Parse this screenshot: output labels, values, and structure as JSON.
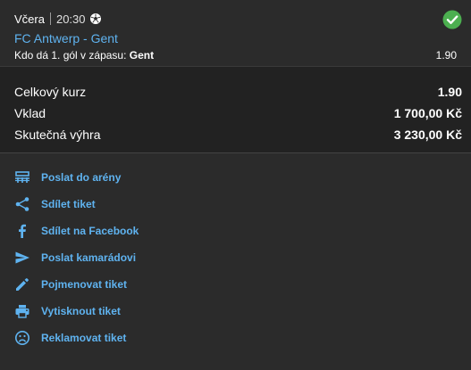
{
  "bet": {
    "day": "Včera",
    "time": "20:30",
    "match": "FC Antwerp - Gent",
    "market_label": "Kdo dá 1. gól v zápasu:",
    "market_value": "Gent",
    "odds": "1.90",
    "sport_icon": "soccer-ball-icon",
    "status_icon": "check-circle-icon"
  },
  "summary": {
    "total_odds_label": "Celkový kurz",
    "total_odds_value": "1.90",
    "stake_label": "Vklad",
    "stake_value": "1 700,00 Kč",
    "payout_label": "Skutečná výhra",
    "payout_value": "3 230,00 Kč"
  },
  "actions": [
    {
      "label": "Poslat do arény",
      "icon": "arena-icon"
    },
    {
      "label": "Sdílet tiket",
      "icon": "share-icon"
    },
    {
      "label": "Sdílet na Facebook",
      "icon": "facebook-icon"
    },
    {
      "label": "Poslat kamarádovi",
      "icon": "send-icon"
    },
    {
      "label": "Pojmenovat tiket",
      "icon": "pencil-icon"
    },
    {
      "label": "Vytisknout tiket",
      "icon": "printer-icon"
    },
    {
      "label": "Reklamovat tiket",
      "icon": "sad-face-icon"
    }
  ],
  "colors": {
    "accent": "#5fb3f0",
    "win": "#4caf50",
    "background": "#2b2b2b",
    "summary_background": "#222222"
  }
}
